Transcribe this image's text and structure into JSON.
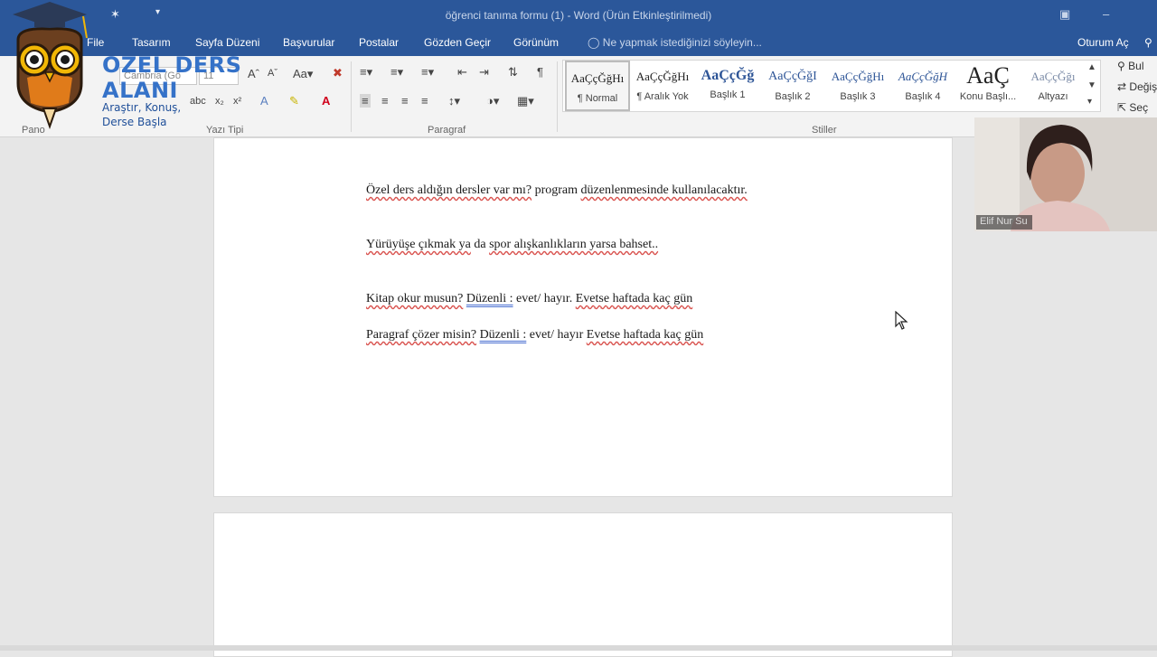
{
  "window": {
    "title": "öğrenci tanıma formu (1) - Word (Ürün Etkinleştirilmedi)"
  },
  "menu": {
    "tabs": [
      "File",
      "Tasarım",
      "Sayfa Düzeni",
      "Başvurular",
      "Postalar",
      "Gözden Geçir",
      "Görünüm"
    ],
    "tell_me": "Ne yapmak istediğinizi söyleyin...",
    "sign_in": "Oturum Aç"
  },
  "ribbon": {
    "font_name": "Cambria (Gö",
    "font_size": "11",
    "group_labels": {
      "clipboard": "Pano",
      "font": "Yazı Tipi",
      "paragraph": "Paragraf",
      "styles": "Stiller"
    },
    "styles": [
      {
        "sample": "AaÇçĞğHı",
        "name": "¶ Normal"
      },
      {
        "sample": "AaÇçĞğHı",
        "name": "¶ Aralık Yok"
      },
      {
        "sample": "AaÇçĞğ",
        "name": "Başlık 1"
      },
      {
        "sample": "AaÇçĞğI",
        "name": "Başlık 2"
      },
      {
        "sample": "AaÇçĞğHı",
        "name": "Başlık 3"
      },
      {
        "sample": "AaÇçĞğH",
        "name": "Başlık 4"
      },
      {
        "sample": "AaÇ",
        "name": "Konu Başlı..."
      },
      {
        "sample": "AaÇçĞğı",
        "name": "Altyazı"
      }
    ],
    "editing": {
      "find": "Bul",
      "replace": "Değiş",
      "select": "Seç"
    }
  },
  "logo": {
    "line1": "OZEL DERS",
    "line2": "ALANI",
    "tagline1": "Araştır, Konuş,",
    "tagline2": "Derse Başla"
  },
  "document": {
    "lines": [
      {
        "a": "Özel ders aldığın dersler var mı?",
        "b": " program ",
        "c": "düzenlenmesinde kullanılacaktır."
      },
      {
        "a": "Yürüyüşe çıkmak ya",
        "b": " da ",
        "c": "spor alışkanlıkların yarsa bahset.."
      },
      {
        "a": "Kitap okur musun?",
        "b": " ",
        "c": "Düzenli :",
        "d": " evet/ hayır.   ",
        "e": "Evetse haftada kaç gün"
      },
      {
        "a": "Paragraf çözer misin?",
        "b": " ",
        "c": "Düzenli :",
        "d": " evet/ hayır   ",
        "e": "Evetse haftada kaç gün"
      }
    ]
  },
  "webcam": {
    "name_tag": "Elif Nur Su"
  },
  "colors": {
    "title_bar": "#2b579a",
    "ribbon": "#f3f3f3",
    "workspace": "#e6e6e6",
    "logo_blue": "#3572c8"
  }
}
